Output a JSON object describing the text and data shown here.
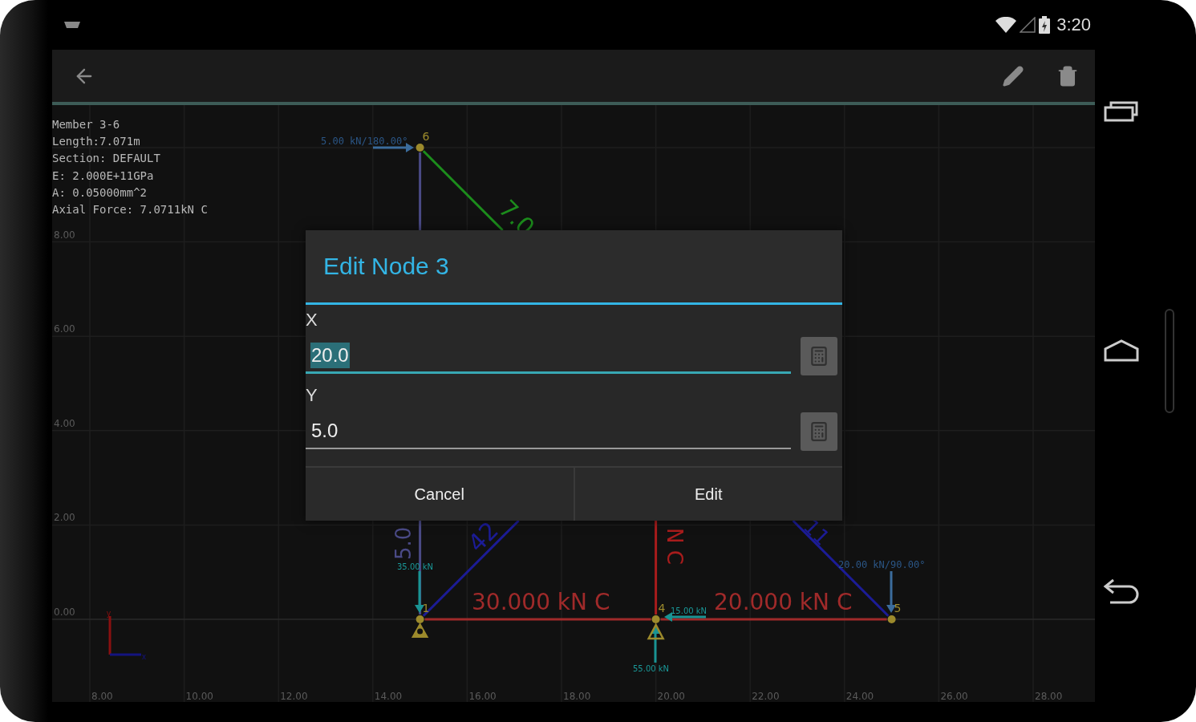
{
  "status_bar": {
    "time": "3:20"
  },
  "member_info": [
    "Member 3-6",
    "Length:7.071m",
    "Section: DEFAULT",
    "E: 2.000E+11GPa",
    "A: 0.05000mm^2",
    "Axial Force: 7.0711kN C"
  ],
  "canvas": {
    "x_ticks": [
      "8.00",
      "10.00",
      "12.00",
      "14.00",
      "16.00",
      "18.00",
      "20.00",
      "22.00",
      "24.00",
      "26.00",
      "28.00"
    ],
    "y_ticks": [
      "8.00",
      "6.00",
      "4.00",
      "2.00",
      "0.00"
    ],
    "axes_marker": {
      "x": "x",
      "y": "y"
    },
    "nodes": [
      {
        "label": "6",
        "kind": "free"
      },
      {
        "label": "1",
        "kind": "pin"
      },
      {
        "label": "4",
        "kind": "roller"
      },
      {
        "label": "5",
        "kind": "free"
      }
    ],
    "members": [
      {
        "label": "5.0",
        "color": "#4a4a86"
      },
      {
        "label": "7.0",
        "color": "#1c8c1c"
      },
      {
        "label": "42",
        "color": "#1c1c96"
      },
      {
        "label": "N C",
        "color": "#a81c1c"
      },
      {
        "label": "11",
        "color": "#1c1c96"
      },
      {
        "label": "30.000 kN C",
        "color": "#a02a2a"
      },
      {
        "label": "20.000 kN C",
        "color": "#a02a2a"
      }
    ],
    "loads": [
      {
        "label": "5.00 kN/180.00°"
      },
      {
        "label": "20.00 kN/90.00°"
      }
    ],
    "reactions": [
      {
        "label": "35.00 kN"
      },
      {
        "label": "15.00 kN"
      },
      {
        "label": "55.00 kN"
      }
    ]
  },
  "dialog": {
    "title": "Edit Node 3",
    "fields": [
      {
        "label": "X",
        "value": "20.0",
        "focused": true
      },
      {
        "label": "Y",
        "value": "5.0",
        "focused": false
      }
    ],
    "buttons": [
      "Cancel",
      "Edit"
    ]
  }
}
